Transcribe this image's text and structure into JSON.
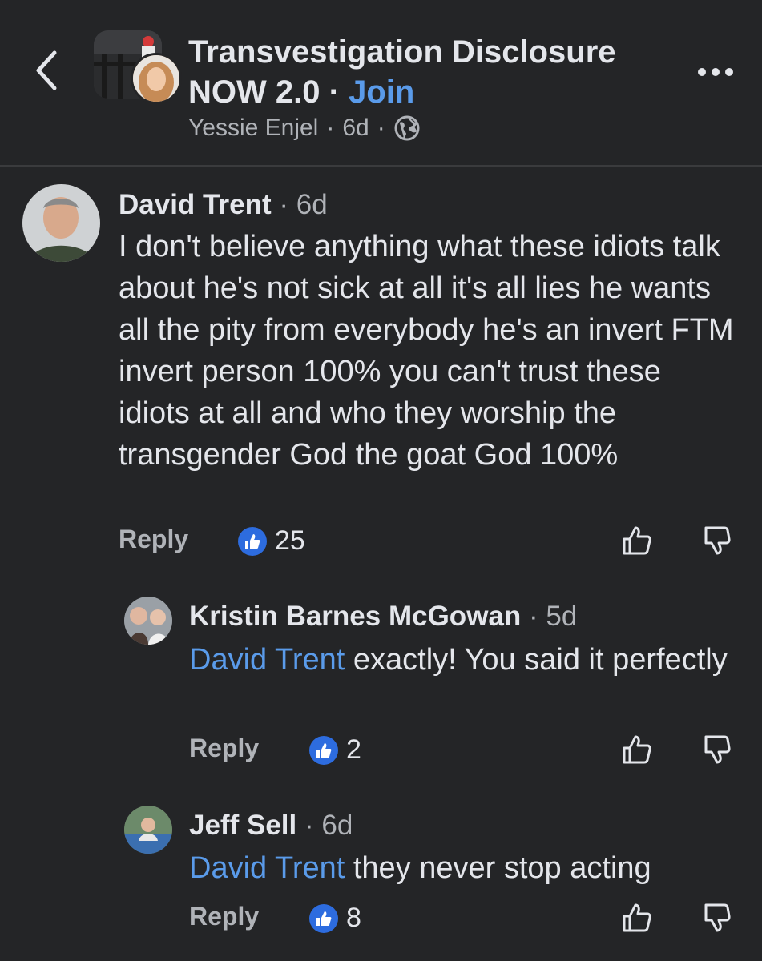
{
  "header": {
    "group_name": "Transvestigation Disclosure NOW 2.0",
    "separator": "·",
    "join_label": "Join",
    "poster_name": "Yessie Enjel",
    "post_age": "6d",
    "audience_icon": "globe-icon",
    "more_icon": "more-icon",
    "back_icon": "chevron-left-icon"
  },
  "comments": [
    {
      "author": "David Trent",
      "time": "6d",
      "text": "I don't believe anything what these idiots talk about he's not sick at all it's all lies he wants all the pity from everybody he's an invert FTM invert person 100% you can't trust these idiots at all and who they worship the transgender God the goat God 100%",
      "reply_label": "Reply",
      "like_count": "25"
    },
    {
      "author": "Kristin Barnes McGowan",
      "time": "5d",
      "mention": "David Trent",
      "text": " exactly! You said it perfectly",
      "reply_label": "Reply",
      "like_count": "2"
    },
    {
      "author": "Jeff Sell",
      "time": "6d",
      "mention": "David Trent",
      "text": " they never stop acting",
      "reply_label": "Reply",
      "like_count": "8"
    }
  ],
  "colors": {
    "background": "#242527",
    "link": "#5a9bea",
    "like_badge": "#2d6cdf",
    "muted": "#b0b3b8"
  }
}
